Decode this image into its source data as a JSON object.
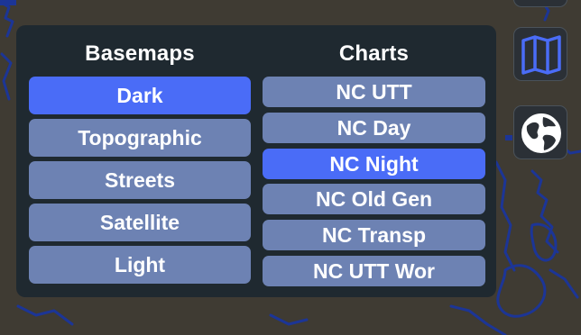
{
  "basemaps": {
    "title": "Basemaps",
    "items": [
      {
        "label": "Dark",
        "active": true
      },
      {
        "label": "Topographic",
        "active": false
      },
      {
        "label": "Streets",
        "active": false
      },
      {
        "label": "Satellite",
        "active": false
      },
      {
        "label": "Light",
        "active": false
      }
    ]
  },
  "charts": {
    "title": "Charts",
    "items": [
      {
        "label": "NC UTT",
        "active": false
      },
      {
        "label": "NC Day",
        "active": false
      },
      {
        "label": "NC Night",
        "active": true
      },
      {
        "label": "NC Old Gen",
        "active": false
      },
      {
        "label": "NC Transp",
        "active": false
      },
      {
        "label": "NC UTT Wor",
        "active": false
      }
    ]
  },
  "toolbar": {
    "icons": [
      "map-icon",
      "globe-icon"
    ]
  },
  "colors": {
    "active": "#4a6cf7",
    "inactive": "#6d82b3",
    "panel": "#1e2830",
    "map_background": "#3f3b33",
    "coastline": "#1e3aa8"
  }
}
